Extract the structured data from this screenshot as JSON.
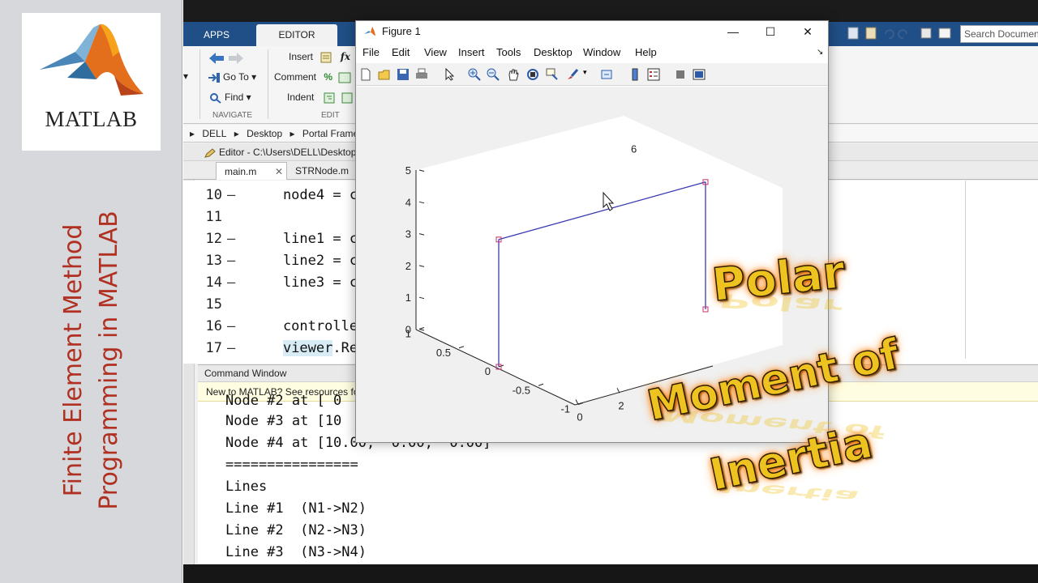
{
  "banner": {
    "logo_text": "MATLAB",
    "title_line1": "Finite Element Method",
    "title_line2": "Programming in MATLAB"
  },
  "ribbon": {
    "tabs": [
      {
        "label": "APPS"
      },
      {
        "label": "EDITOR"
      }
    ],
    "navigate": {
      "goto_label": "Go To",
      "find_label": "Find",
      "group_label": "NAVIGATE"
    },
    "edit": {
      "insert_label": "Insert",
      "comment_label": "Comment",
      "indent_label": "Indent",
      "group_label": "EDIT"
    },
    "search_placeholder": "Search Documentation"
  },
  "breadcrumb": {
    "items": [
      "DELL",
      "Desktop",
      "Portal Frame"
    ]
  },
  "editor": {
    "header": "Editor - C:\\Users\\DELL\\Desktop",
    "tabs": [
      {
        "label": "main.m"
      },
      {
        "label": "STRNode.m"
      }
    ],
    "lines": [
      {
        "num": "10",
        "dash": "—",
        "code": "    node4 = co"
      },
      {
        "num": "11",
        "dash": "",
        "code": ""
      },
      {
        "num": "12",
        "dash": "—",
        "code": "    line1 = co"
      },
      {
        "num": "13",
        "dash": "—",
        "code": "    line2 = co"
      },
      {
        "num": "14",
        "dash": "—",
        "code": "    line3 = co"
      },
      {
        "num": "15",
        "dash": "",
        "code": ""
      },
      {
        "num": "16",
        "dash": "—",
        "code": "    controlle"
      },
      {
        "num": "17",
        "dash": "—",
        "code_hl": "viewer",
        "code_rest": ".Re"
      }
    ]
  },
  "command_window": {
    "title": "Command Window",
    "notice": "New to MATLAB? See resources fo",
    "lines": [
      "Node #2 at [ 0",
      "Node #3 at [10",
      "Node #4 at [10.00,  0.00,  0.00]",
      "================",
      "Lines",
      "Line #1  (N1->N2)",
      "Line #2  (N2->N3)",
      "Line #3  (N3->N4)"
    ]
  },
  "figure": {
    "title": "Figure 1",
    "menu": [
      "File",
      "Edit",
      "View",
      "Insert",
      "Tools",
      "Desktop",
      "Window",
      "Help"
    ],
    "window_controls": {
      "minimize": "—",
      "maximize": "☐",
      "close": "✕"
    },
    "toolbar_icons": [
      "new-figure-icon",
      "open-icon",
      "save-icon",
      "print-icon",
      "pointer-icon",
      "zoom-in-icon",
      "zoom-out-icon",
      "pan-icon",
      "rotate-icon",
      "data-cursor-icon",
      "brush-icon",
      "link-icon",
      "colorbar-icon",
      "legend-icon",
      "hide-plot-tools-icon",
      "show-plot-tools-icon"
    ],
    "axes": {
      "z_ticks": [
        "0",
        "1",
        "2",
        "3",
        "4",
        "5"
      ],
      "y_ticks": [
        "1",
        "0.5",
        "0",
        "-0.5",
        "-1"
      ],
      "x_ticks": [
        "0",
        "2"
      ],
      "partial_tick": "6"
    }
  },
  "chart_data": {
    "type": "line",
    "title": "",
    "xlabel": "",
    "ylabel": "",
    "zlabel": "",
    "view": "3d",
    "zlim": [
      0,
      5
    ],
    "ylim": [
      -1,
      1
    ],
    "nodes": [
      {
        "x": 0,
        "y": 0,
        "z": 0
      },
      {
        "x": 0,
        "y": 0,
        "z": 4
      },
      {
        "x": 10,
        "y": 0,
        "z": 4
      },
      {
        "x": 10,
        "y": 0,
        "z": 0
      }
    ],
    "lines": [
      [
        1,
        2
      ],
      [
        2,
        3
      ],
      [
        3,
        4
      ]
    ],
    "line_color": "#3b3bb0",
    "marker_color": "#c8326e"
  },
  "overlay": {
    "line1": "Polar",
    "line2": "Moment of",
    "line3": "Inertia",
    "text_color": "#efc31f",
    "glow_color": "#ff8a1a"
  }
}
